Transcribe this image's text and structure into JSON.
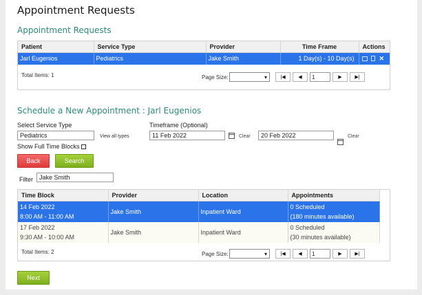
{
  "page_title": "Appointment Requests",
  "requests": {
    "section_title": "Appointment Requests",
    "columns": [
      "Patient",
      "Service Type",
      "Provider",
      "Time Frame",
      "Actions"
    ],
    "rows": [
      {
        "patient": "Jarl Eugenios",
        "service_type": "Pediatrics",
        "provider": "Jake Smith",
        "time_frame": "1 Day(s) - 10 Day(s)"
      }
    ],
    "total_items": "Total Items: 1",
    "page_size_label": "Page Size:",
    "page_number": "1"
  },
  "schedule": {
    "section_title": "Schedule a New Appointment : Jarl Eugenios",
    "service_type_label": "Select Service Type",
    "service_type_value": "Pediatrics",
    "view_all_types": "View all types",
    "show_full_time_blocks": "Show Full Time Blocks",
    "timeframe_label": "Timeframe (Optional)",
    "date_from": "11 Feb 2022",
    "date_to": "20 Feb 2022",
    "clear_label": "Clear",
    "back_label": "Back",
    "search_label": "Search",
    "filter_label": "Filter",
    "filter_value": "Jake Smith"
  },
  "blocks": {
    "columns": [
      "Time Block",
      "Provider",
      "Location",
      "Appointments"
    ],
    "rows": [
      {
        "date": "14 Feb 2022",
        "time": "8:00 AM - 11:00 AM",
        "provider": "Jake Smith",
        "location": "Inpatient Ward",
        "scheduled": "0 Scheduled",
        "available": "(180 minutes available)"
      },
      {
        "date": "17 Feb 2022",
        "time": "9:30 AM - 10:00 AM",
        "provider": "Jake Smith",
        "location": "Inpatient Ward",
        "scheduled": "0 Scheduled",
        "available": "(30 minutes available)"
      }
    ],
    "total_items": "Total Items: 2",
    "page_size_label": "Page Size:",
    "page_number": "1"
  },
  "next_label": "Next",
  "pager_icons": [
    "first-page-icon",
    "prev-page-icon",
    "next-page-icon",
    "last-page-icon"
  ],
  "action_icons": [
    "calendar-icon",
    "document-icon",
    "close-icon"
  ],
  "colors": {
    "accent": "#2e8a7a",
    "selected_row": "#2b73e8",
    "back_button": "#e23a3a",
    "green_button": "#7eb01e"
  }
}
